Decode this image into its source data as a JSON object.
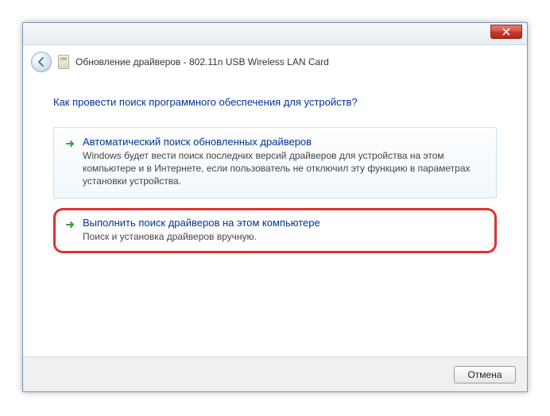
{
  "titlebar": {
    "title": "Обновление драйверов - 802.11n USB Wireless LAN Card"
  },
  "heading": "Как провести поиск программного обеспечения для устройств?",
  "options": [
    {
      "title": "Автоматический поиск обновленных драйверов",
      "desc": "Windows будет вести поиск последних версий драйверов для устройства на этом компьютере и в Интернете, если пользователь не отключил эту функцию в параметрах установки устройства."
    },
    {
      "title": "Выполнить поиск драйверов на этом компьютере",
      "desc": "Поиск и установка драйверов вручную."
    }
  ],
  "footer": {
    "cancel": "Отмена"
  }
}
